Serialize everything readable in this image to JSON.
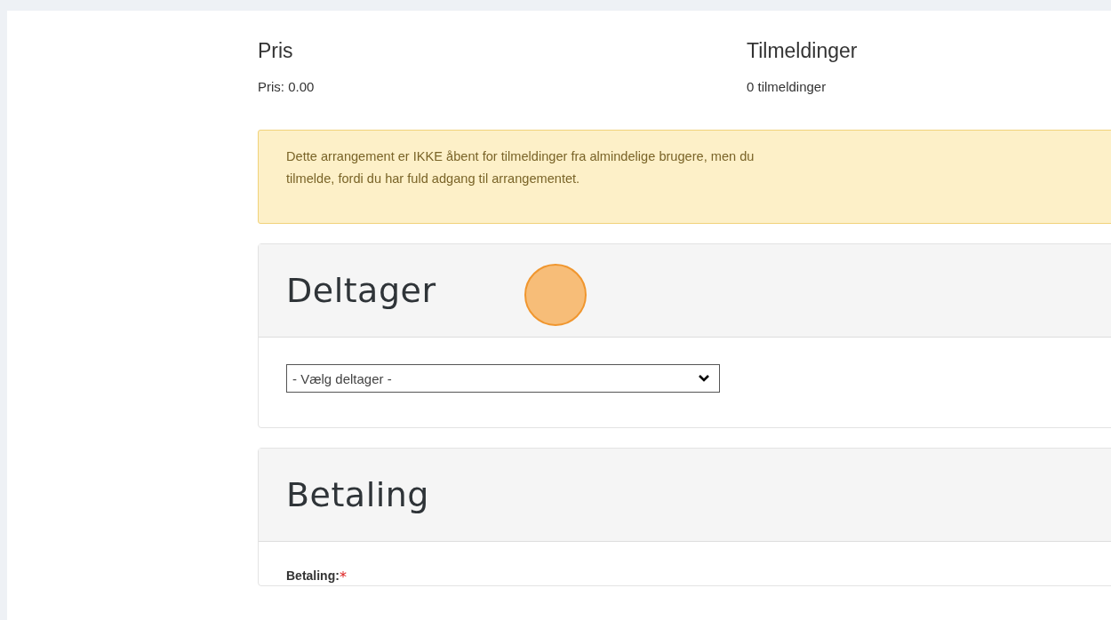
{
  "summary": [
    {
      "heading": "Pris",
      "value": "Pris: 0.00"
    },
    {
      "heading": "Tilmeldinger",
      "value": "0 tilmeldinger"
    }
  ],
  "alert": {
    "lines": [
      "Dette arrangement er IKKE åbent for tilmeldinger fra almindelige brugere, men du",
      "tilmelde, fordi du har fuld adgang til arrangementet."
    ]
  },
  "cards": [
    {
      "title": "Deltager",
      "kind": "select",
      "select": {
        "value": "- Vælg deltager -"
      }
    },
    {
      "title": "Betaling",
      "kind": "label",
      "label": {
        "text": "Betaling:",
        "required_mark": "*"
      }
    }
  ]
}
